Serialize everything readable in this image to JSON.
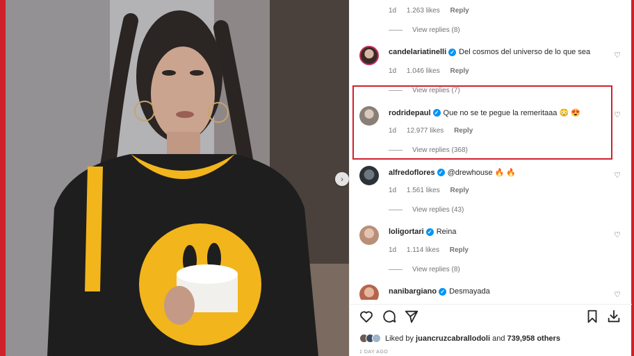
{
  "post": {
    "next_button": "›"
  },
  "comments": {
    "top_partial": {
      "time": "1d",
      "likes": "1.263 likes",
      "reply": "Reply",
      "view_replies": "View replies (8)"
    },
    "items": [
      {
        "username": "candelariatinelli",
        "text": "Del cosmos del universo de lo que sea",
        "time": "1d",
        "likes": "1.046 likes",
        "reply": "Reply",
        "view_replies": "View replies (7)"
      },
      {
        "username": "rodridepaul",
        "text": "Que no se te pegue la remeritaaa 😳 😍",
        "time": "1d",
        "likes": "12.977 likes",
        "reply": "Reply",
        "view_replies": "View replies (368)"
      },
      {
        "username": "alfredoflores",
        "text": "@drewhouse 🔥 🔥",
        "time": "1d",
        "likes": "1.561 likes",
        "reply": "Reply",
        "view_replies": "View replies (43)"
      },
      {
        "username": "loligortari",
        "text": "Reina",
        "time": "1d",
        "likes": "1.114 likes",
        "reply": "Reply",
        "view_replies": "View replies (8)"
      },
      {
        "username": "nanibargiano",
        "text": "Desmayada"
      }
    ]
  },
  "actions": {
    "liked_prefix": "Liked by",
    "liked_user": "juancruzcabrallodoli",
    "liked_and": "and",
    "liked_count": "739,958 others",
    "timestamp": "1 DAY AGO"
  },
  "colors": {
    "highlight": "#d0202a",
    "verified": "#0095f6",
    "shirt": "#1e1e1e",
    "logo": "#f2b51c"
  }
}
